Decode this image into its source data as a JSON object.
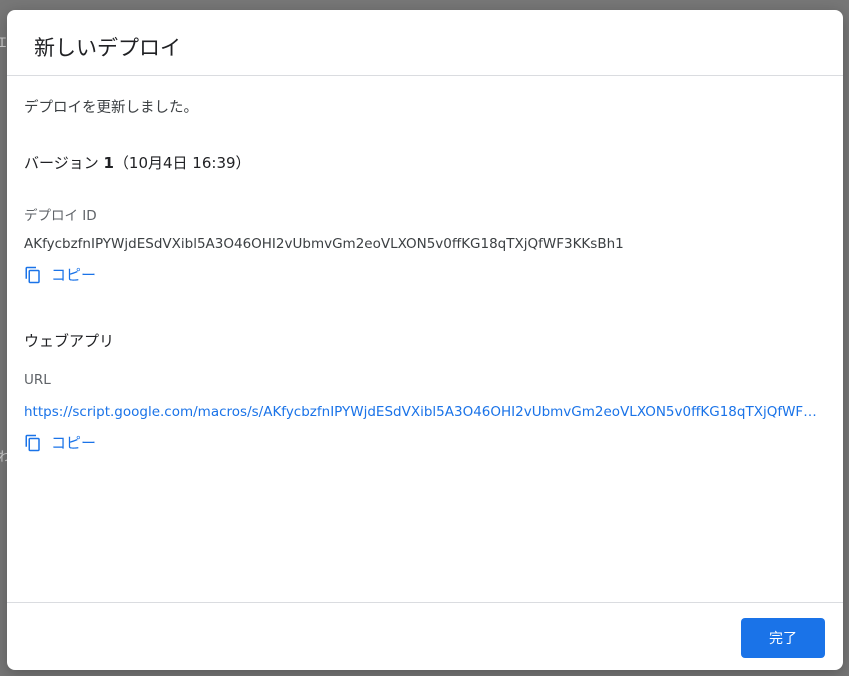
{
  "background": {
    "peek_left": "Ꮖ",
    "peek_bottom": "わ"
  },
  "dialog": {
    "title": "新しいデプロイ",
    "message": "デプロイを更新しました。",
    "version": {
      "prefix": "バージョン ",
      "number": "1",
      "date": "（10月4日 16:39）"
    },
    "deploy_id": {
      "label": "デプロイ ID",
      "value": "AKfycbzfnIPYWjdESdVXibl5A3O46OHI2vUbmvGm2eoVLXON5v0ffKG18qTXjQfWF3KKsBh1",
      "copy_label": "コピー"
    },
    "webapp": {
      "section_title": "ウェブアプリ",
      "url_label": "URL",
      "url_value": "https://script.google.com/macros/s/AKfycbzfnIPYWjdESdVXibl5A3O46OHI2vUbmvGm2eoVLXON5v0ffKG18qTXjQfWF3…",
      "copy_label": "コピー"
    },
    "done_label": "完了"
  },
  "colors": {
    "accent": "#1a73e8",
    "overlay": "#777777"
  },
  "icons": {
    "copy": "copy-icon"
  }
}
